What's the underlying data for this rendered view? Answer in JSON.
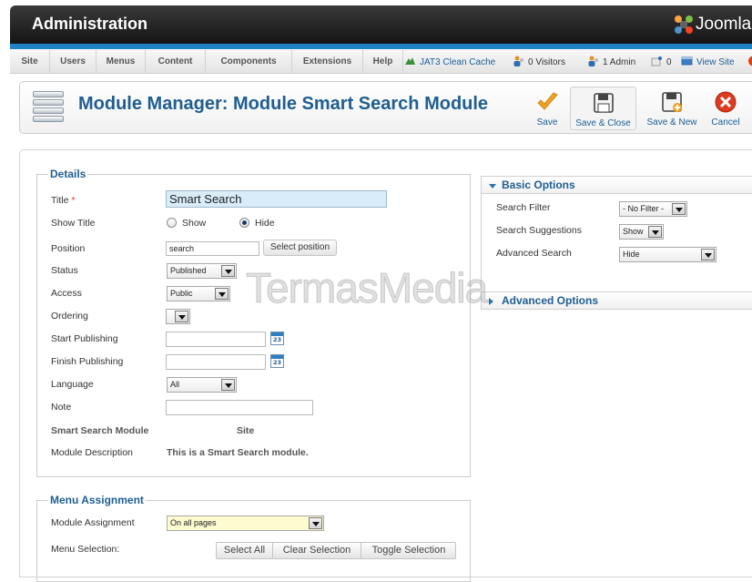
{
  "header": {
    "title": "Administration",
    "logo_text": "Joomla!"
  },
  "menu": {
    "items": [
      "Site",
      "Users",
      "Menus",
      "Content",
      "Components",
      "Extensions",
      "Help"
    ]
  },
  "status": {
    "cache": "JAT3 Clean Cache",
    "visitors": "0 Visitors",
    "admins": "1 Admin",
    "messages": "0",
    "view_site": "View Site"
  },
  "toolbar": {
    "page_title": "Module Manager: Module Smart Search Module",
    "save": "Save",
    "save_close": "Save & Close",
    "save_new": "Save & New",
    "cancel": "Cancel"
  },
  "details": {
    "legend": "Details",
    "title_label": "Title",
    "required_mark": "*",
    "title_value": "Smart Search",
    "show_title_label": "Show Title",
    "show_title_options": [
      "Show",
      "Hide"
    ],
    "show_title_selected": "Hide",
    "position_label": "Position",
    "position_value": "search",
    "select_position": "Select position",
    "status_label": "Status",
    "status_value": "Published",
    "access_label": "Access",
    "access_value": "Public",
    "ordering_label": "Ordering",
    "ordering_value": "",
    "start_publishing_label": "Start Publishing",
    "start_publishing_value": "",
    "finish_publishing_label": "Finish Publishing",
    "finish_publishing_value": "",
    "calendar_day": "23",
    "language_label": "Language",
    "language_value": "All",
    "note_label": "Note",
    "note_value": "",
    "module_type": "Smart Search Module",
    "module_client": "Site",
    "description_label": "Module Description",
    "description_value": "This is a Smart Search module."
  },
  "basic_options": {
    "header": "Basic Options",
    "search_filter_label": "Search Filter",
    "search_filter_value": "- No Filter -",
    "search_suggestions_label": "Search Suggestions",
    "search_suggestions_value": "Show",
    "advanced_search_label": "Advanced Search",
    "advanced_search_value": "Hide"
  },
  "advanced_options": {
    "header": "Advanced Options"
  },
  "menu_assignment": {
    "legend": "Menu Assignment",
    "assignment_label": "Module Assignment",
    "assignment_value": "On all pages",
    "selection_label": "Menu Selection:",
    "select_all": "Select All",
    "clear_selection": "Clear Selection",
    "toggle_selection": "Toggle Selection"
  },
  "watermark": "TermasMedia",
  "colors": {
    "brand_blue": "#1f5e91",
    "header_dark": "#1e1e1e",
    "stripe_blue": "#1f83c6",
    "title_input_bg": "#d8ecf9",
    "assignment_select_bg": "#fdfbd0"
  }
}
